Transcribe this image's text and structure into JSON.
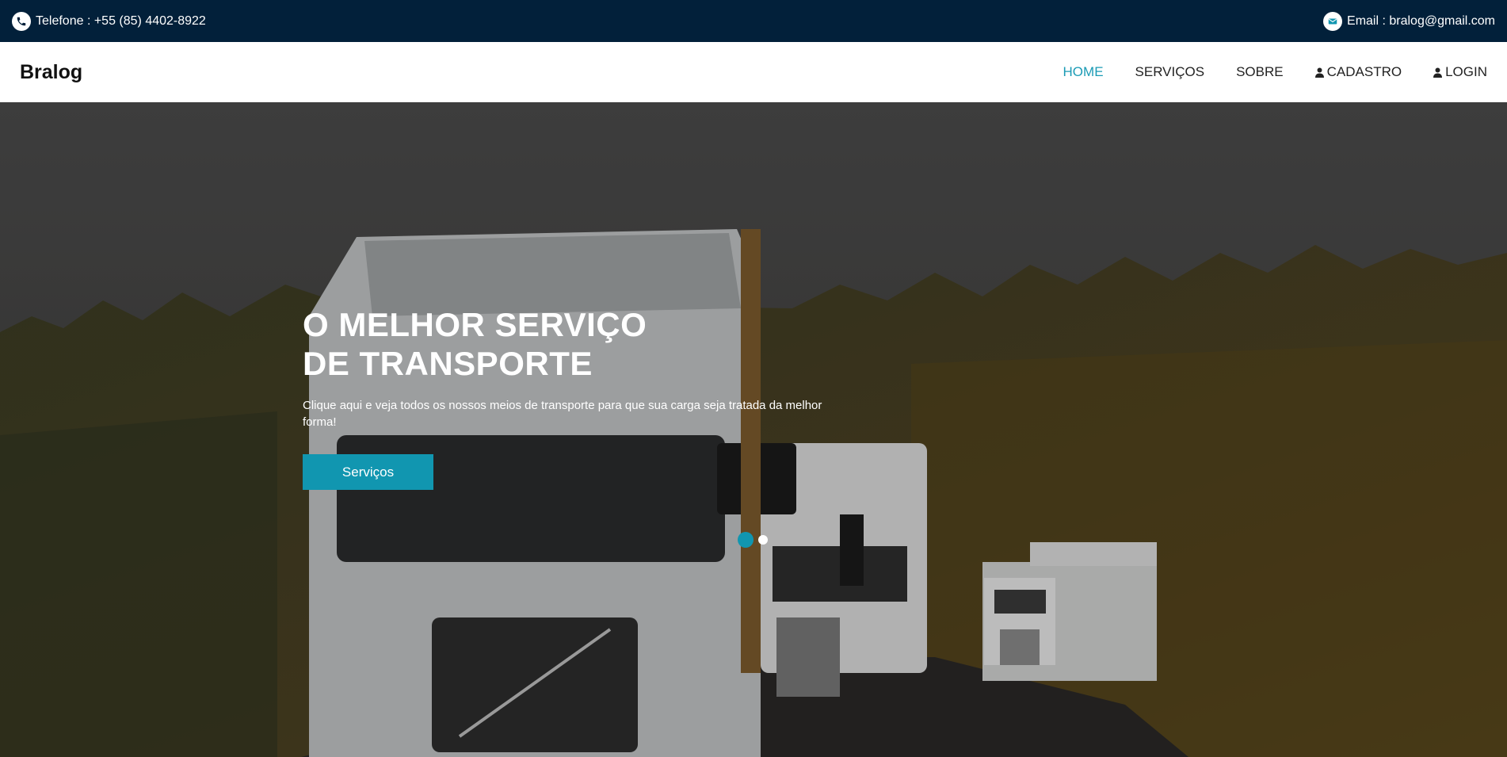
{
  "topbar": {
    "phone_text": "Telefone : +55 (85) 4402-8922",
    "email_text": "Email : bralog@gmail.com",
    "phone_icon": "phone-icon",
    "email_icon": "envelope-icon"
  },
  "navbar": {
    "brand": "Bralog",
    "items": [
      {
        "label": "HOME",
        "active": true
      },
      {
        "label": "SERVIÇOS"
      },
      {
        "label": "SOBRE"
      },
      {
        "label": "CADASTRO",
        "icon": "user-icon"
      },
      {
        "label": "LOGIN",
        "icon": "user-icon"
      }
    ]
  },
  "hero": {
    "title_line1": "O MELHOR SERVIÇO",
    "title_line2": "DE TRANSPORTE",
    "subtitle": "Clique aqui e veja todos os nossos meios de transporte para que sua carga seja tratada da melhor forma!",
    "button_label": "Serviços",
    "slides_total": 2,
    "active_slide": 1
  },
  "colors": {
    "topbar_bg": "#02203a",
    "accent": "#1196b0",
    "nav_active": "#1b9bb5"
  }
}
